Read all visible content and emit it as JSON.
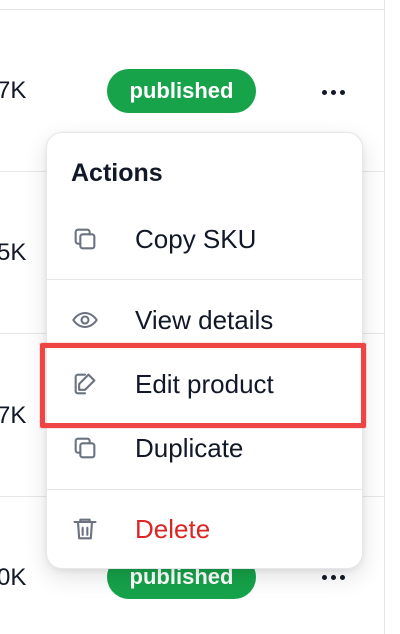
{
  "table": {
    "rows": [
      {
        "value": "7K",
        "status": "published",
        "actions_label": "Open row actions"
      },
      {
        "value": "5K"
      },
      {
        "value": "7K"
      },
      {
        "value": "0K",
        "status": "published",
        "actions_label": "Open row actions"
      }
    ]
  },
  "menu": {
    "heading": "Actions",
    "items": [
      {
        "label": "Copy SKU",
        "icon": "copy-icon"
      },
      {
        "label": "View details",
        "icon": "eye-icon"
      },
      {
        "label": "Edit product",
        "icon": "edit-icon"
      },
      {
        "label": "Duplicate",
        "icon": "copy-icon"
      },
      {
        "label": "Delete",
        "icon": "trash-icon"
      }
    ]
  },
  "colors": {
    "badge_background": "#16a34a",
    "badge_text": "#ffffff",
    "danger": "#dc2626",
    "highlight_border": "#ef4444",
    "muted_icon": "#6b7280",
    "text": "#111827"
  }
}
